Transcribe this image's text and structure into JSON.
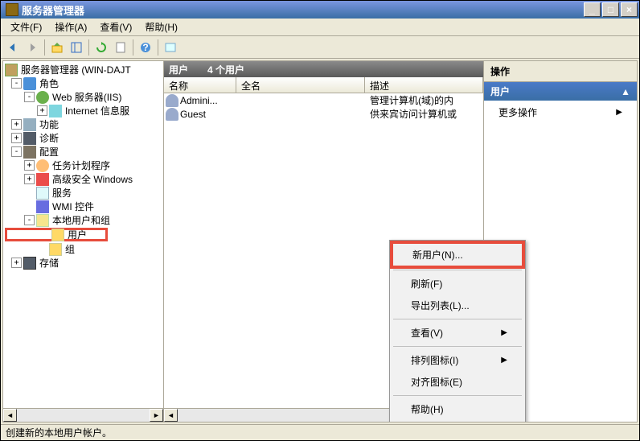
{
  "window": {
    "title": "服务器管理器"
  },
  "menubar": {
    "file": "文件(F)",
    "action": "操作(A)",
    "view": "查看(V)",
    "help": "帮助(H)"
  },
  "tree": {
    "root": "服务器管理器 (WIN-DAJT",
    "roles": "角色",
    "web_server": "Web 服务器(IIS)",
    "iis": "Internet 信息服",
    "features": "功能",
    "diagnostics": "诊断",
    "configuration": "配置",
    "task_scheduler": "任务计划程序",
    "advanced_security": "高级安全 Windows",
    "services": "服务",
    "wmi": "WMI 控件",
    "local_users": "本地用户和组",
    "users": "用户",
    "groups": "组",
    "storage": "存储"
  },
  "list": {
    "header_title": "用户",
    "header_count": "4 个用户",
    "col_name": "名称",
    "col_fullname": "全名",
    "col_desc": "描述",
    "rows": [
      {
        "name": "Admini...",
        "fullname": "",
        "desc": "管理计算机(域)的内"
      },
      {
        "name": "Guest",
        "fullname": "",
        "desc": "供来宾访问计算机或"
      }
    ]
  },
  "context_menu": {
    "new_user": "新用户(N)...",
    "refresh": "刷新(F)",
    "export_list": "导出列表(L)...",
    "view": "查看(V)",
    "arrange_icons": "排列图标(I)",
    "align_icons": "对齐图标(E)",
    "help": "帮助(H)"
  },
  "actions": {
    "title": "操作",
    "section": "用户",
    "more_actions": "更多操作"
  },
  "statusbar": {
    "text": "创建新的本地用户帐户。"
  }
}
